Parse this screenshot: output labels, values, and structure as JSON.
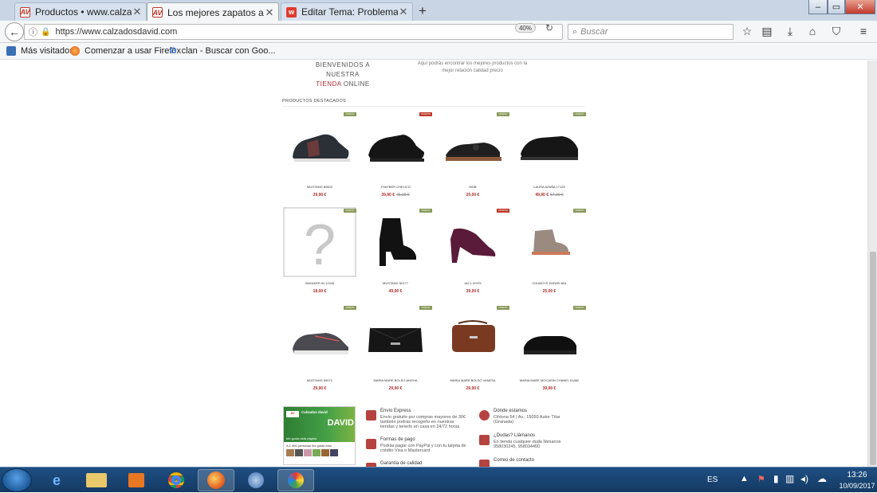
{
  "tabs": [
    {
      "title": "Productos • www.calzadosda",
      "active": false,
      "icon": "AV"
    },
    {
      "title": "Los mejores zapatos a buen p",
      "active": true,
      "icon": "AV"
    },
    {
      "title": "Editar Tema: Problema al ord",
      "active": false,
      "icon": "w"
    }
  ],
  "nav": {
    "url": "https://www.calzadosdavid.com",
    "zoom": "40%",
    "search_placeholder": "Buscar"
  },
  "bookmarks": [
    "Más visitados",
    "Comenzar a usar Firefox",
    "clan - Buscar con Goo..."
  ],
  "page": {
    "welcome_line1": "BIENVENIDOS A NUESTRA",
    "welcome_red": "TIENDA",
    "welcome_end": "ONLINE",
    "intro": "Aquí podrás encontrar los mejores productos con la mejor relación calidad precio",
    "featured_title": "PRODUCTOS DESTACADOS",
    "products": [
      {
        "name": "MUSTANG 82603",
        "price": "29,90 €",
        "old": "",
        "badge": "NUEVO",
        "icon": "sneaker-dark"
      },
      {
        "name": "J'HAYBER CHELICO",
        "price": "39,90 €",
        "old": "45,00 €",
        "badge": "OFERTA",
        "icon": "sneaker-black"
      },
      {
        "name": "MOB",
        "price": "20,00 €",
        "old": "",
        "badge": "NUEVO",
        "icon": "loafer-brown"
      },
      {
        "name": "LAURA AZAÑA 17125",
        "price": "49,90 €",
        "old": "57,00 €",
        "badge": "NUEVO",
        "icon": "shoe-black"
      },
      {
        "name": "SNEAKER IN 12345",
        "price": "18,00 €",
        "old": "",
        "badge": "NUEVO",
        "icon": "placeholder"
      },
      {
        "name": "MUSTANG 50177",
        "price": "49,90 €",
        "old": "",
        "badge": "NUEVO",
        "icon": "boot-black"
      },
      {
        "name": "JACL NYES",
        "price": "39,00 €",
        "old": "",
        "badge": "OFERTA",
        "icon": "heel-purple"
      },
      {
        "name": "CHUBOYS SAFARI 804",
        "price": "25,00 €",
        "old": "",
        "badge": "NUEVO",
        "icon": "bootie-speckled"
      },
      {
        "name": "MUSTANG 69071",
        "price": "29,90 €",
        "old": "",
        "badge": "NUEVO",
        "icon": "sneaker-grey"
      },
      {
        "name": "MARIA MARE BOLSO ANGHA",
        "price": "29,90 €",
        "old": "",
        "badge": "NUEVO",
        "icon": "bag-black"
      },
      {
        "name": "MARIA MARE BOLSO VANESA",
        "price": "29,90 €",
        "old": "",
        "badge": "NUEVO",
        "icon": "bag-brown"
      },
      {
        "name": "MARIA MARE MOCASIN CHANEL 61882",
        "price": "39,90 €",
        "old": "",
        "badge": "NUEVO",
        "icon": "loafer-black"
      }
    ],
    "fb": {
      "title": "Calzados david",
      "subtitle": "Me gusta esta página",
      "big": "DAVID",
      "caption": "A 2.406 personas les gusta esto"
    },
    "info": [
      {
        "title": "Envío Express",
        "text": "Envío gratuito por compras mayores de 30€ también podrás recogerlo en nuestras tiendas y tenerlo en casa en 24/72 horas"
      },
      {
        "title": "Formas de pago",
        "text": "Podrás pagar con PayPal y con tu tarjeta de crédito Visa o Mastercard"
      },
      {
        "title": "Garantía de calidad",
        "text": ""
      },
      {
        "title": "Dónde estamos",
        "text": "Cihtona 54 | Av., 15050 Autor Títar (Granada)"
      },
      {
        "title": "¿Dudas? Llámanos",
        "text": "En tienda cualquier duda llámanos 958030245, 958034450"
      },
      {
        "title": "Correo de contacto",
        "text": ""
      }
    ]
  },
  "taskbar": {
    "lang": "ES",
    "time": "13:26",
    "date": "10/09/2017"
  }
}
